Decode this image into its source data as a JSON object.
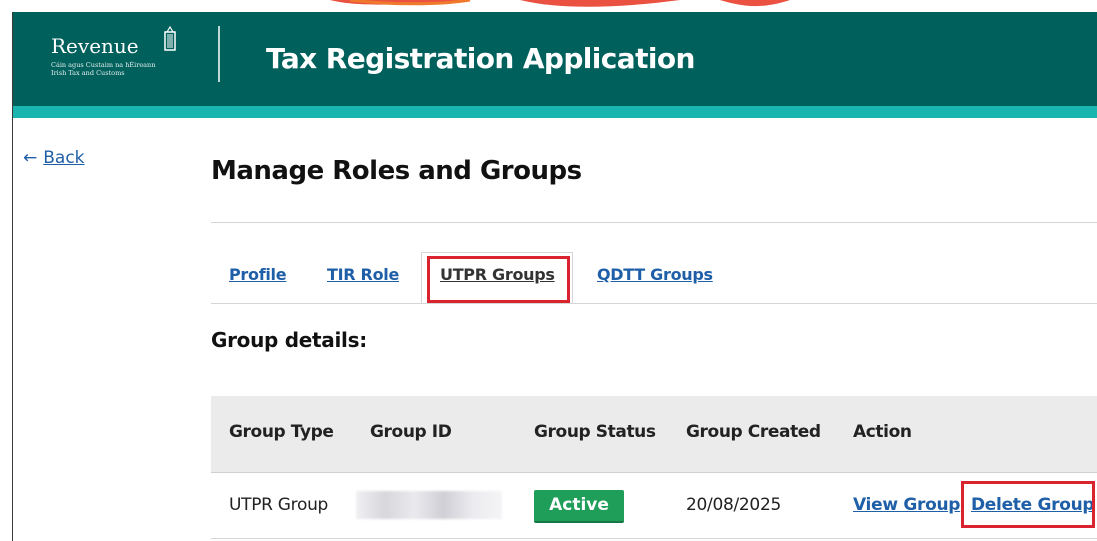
{
  "header": {
    "logo_word": "Revenue",
    "logo_sub_line1": "Cáin agus Custaim na hÉireann",
    "logo_sub_line2": "Irish Tax and Customs",
    "app_title": "Tax Registration Application"
  },
  "nav": {
    "back_label": "Back",
    "back_arrow": "←"
  },
  "page": {
    "title": "Manage Roles and Groups"
  },
  "tabs": [
    {
      "label": "Profile",
      "active": false
    },
    {
      "label": "TIR Role",
      "active": false
    },
    {
      "label": "UTPR Groups",
      "active": true
    },
    {
      "label": "QDTT Groups",
      "active": false
    }
  ],
  "section": {
    "title": "Group details:"
  },
  "table": {
    "headers": [
      "Group Type",
      "Group ID",
      "Group Status",
      "Group Created",
      "Action"
    ],
    "rows": [
      {
        "group_type": "UTPR Group",
        "group_id": "",
        "group_status": "Active",
        "group_created": "20/08/2025",
        "actions": [
          "View Group",
          "Delete Group"
        ]
      }
    ]
  },
  "colors": {
    "header_bg": "#00605c",
    "header_stripe": "#1bb5b0",
    "link": "#1f5fa8",
    "status_active": "#1f9e5a",
    "highlight": "#d9232e"
  }
}
